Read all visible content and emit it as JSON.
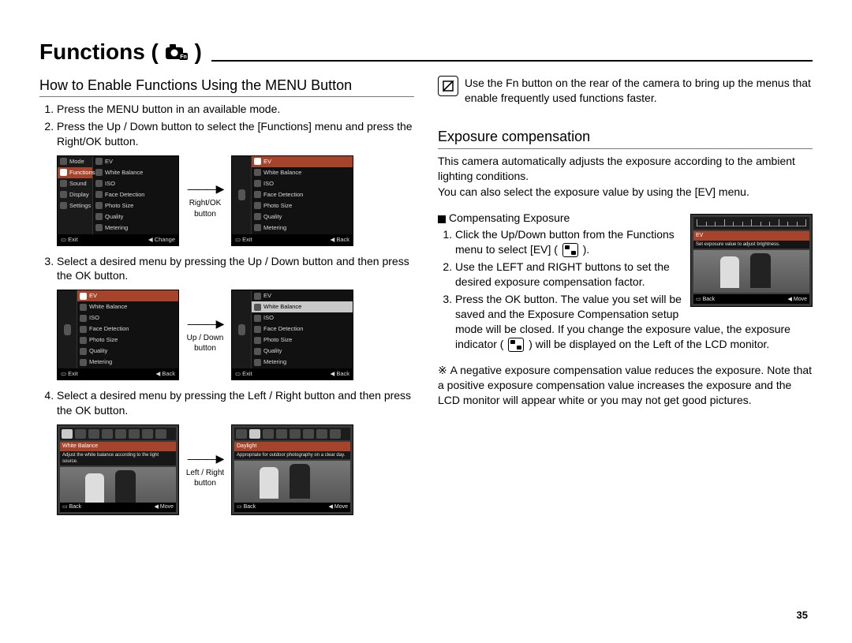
{
  "page_number": "35",
  "title": "Functions (",
  "title_close": " )",
  "left": {
    "heading": "How to Enable Functions Using the MENU Button",
    "step1": "Press the MENU button in an available mode.",
    "step2": "Press the Up / Down button to select the [Functions] menu and press the Right/OK button.",
    "step3": "Select a desired menu by pressing the Up / Down button and then press the OK button.",
    "step4": "Select a desired menu by pressing the Left / Right button and then press the OK button.",
    "arrow1": "Right/OK button",
    "arrow2": "Up / Down button",
    "arrow3": "Left / Right button",
    "menu_left": {
      "items": [
        "Mode",
        "Functions",
        "Sound",
        "Display",
        "Settings"
      ],
      "selected": 1
    },
    "menu_right": {
      "items": [
        "EV",
        "White Balance",
        "ISO",
        "Face Detection",
        "Photo Size",
        "Quality",
        "Metering"
      ]
    },
    "footer_exit": "Exit",
    "footer_change": "Change",
    "footer_back": "Back",
    "footer_move": "Move",
    "wb_a_title": "White Balance",
    "wb_a_desc": "Adjust the white balance according to the light source.",
    "wb_b_title": "Daylight",
    "wb_b_desc": "Appropriate for outdoor photography on a clear day."
  },
  "right": {
    "note": "Use the Fn button on the rear of the camera to bring up the menus that enable frequently used functions faster.",
    "heading": "Exposure compensation",
    "intro1": "This camera automatically adjusts the exposure according to the ambient lighting conditions.",
    "intro2": "You can also select the exposure value by using the [EV] menu.",
    "sub": "Compensating Exposure",
    "s1a": "Click the Up/Down button from the Functions menu to select [EV] (",
    "s1b": " ).",
    "s2": "Use the LEFT and RIGHT buttons to set the desired exposure compensation factor.",
    "s3a": "Press the OK button. The value you set will be saved and the Exposure Compensation setup mode will be closed. If you change the exposure value, the exposure indicator (",
    "s3b": " ) will be displayed on the Left of the LCD monitor.",
    "warn": "A negative exposure compensation value reduces the exposure. Note that a positive exposure compensation value increases the exposure and the LCD monitor will appear white or you may not get good pictures.",
    "ev_label": "EV",
    "ev_desc": "Set exposure value to adjust brightness.",
    "ev_back": "Back",
    "ev_move": "Move"
  }
}
